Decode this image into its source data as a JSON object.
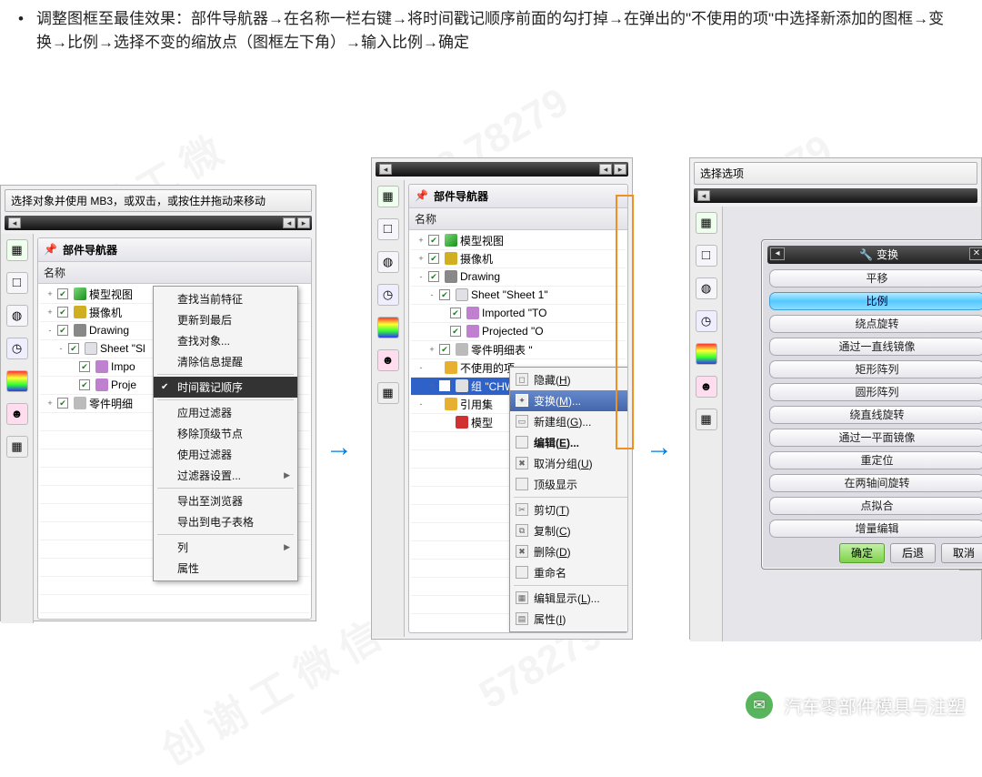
{
  "bullet": "调整图框至最佳效果：部件导航器→在名称一栏右键→将时间戳记顺序前面的勾打掉→在弹出的\"不使用的项\"中选择新添加的图框→变换→比例→选择不变的缩放点（图框左下角）→输入比例→确定",
  "shared": {
    "nav_title": "部件导航器",
    "col_name": "名称"
  },
  "shot1": {
    "hint": "选择对象并使用 MB3，或双击，或按住并拖动来移动",
    "tree": [
      {
        "pad": 0,
        "exp": "+",
        "chk": true,
        "ico": "cube3",
        "label": "模型视图"
      },
      {
        "pad": 0,
        "exp": "+",
        "chk": true,
        "ico": "cam",
        "label": "摄像机"
      },
      {
        "pad": 0,
        "exp": "-",
        "chk": true,
        "ico": "draw",
        "label": "Drawing"
      },
      {
        "pad": 1,
        "exp": "-",
        "chk": true,
        "ico": "sheet",
        "label": "Sheet \"Sl"
      },
      {
        "pad": 2,
        "exp": "",
        "chk": true,
        "ico": "view",
        "label": "Impo"
      },
      {
        "pad": 2,
        "exp": "",
        "chk": true,
        "ico": "view",
        "label": "Proje"
      },
      {
        "pad": 0,
        "exp": "+",
        "chk": true,
        "ico": "part",
        "label": "零件明细"
      }
    ],
    "ctx": {
      "items": [
        {
          "t": "查找当前特征"
        },
        {
          "t": "更新到最后"
        },
        {
          "t": "查找对象..."
        },
        {
          "t": "清除信息提醒"
        },
        {
          "sep": true
        },
        {
          "t": "时间戳记顺序",
          "check": true,
          "hi": true
        },
        {
          "sep": true
        },
        {
          "t": "应用过滤器"
        },
        {
          "t": "移除顶级节点"
        },
        {
          "t": "使用过滤器"
        },
        {
          "t": "过滤器设置...",
          "arr": true
        },
        {
          "sep": true
        },
        {
          "t": "导出至浏览器"
        },
        {
          "t": "导出到电子表格"
        },
        {
          "sep": true
        },
        {
          "t": "列",
          "arr": true
        },
        {
          "t": "属性"
        }
      ]
    }
  },
  "shot2": {
    "tree": [
      {
        "pad": 0,
        "exp": "+",
        "chk": true,
        "ico": "cube3",
        "label": "模型视图"
      },
      {
        "pad": 0,
        "exp": "+",
        "chk": true,
        "ico": "cam",
        "label": "摄像机"
      },
      {
        "pad": 0,
        "exp": "-",
        "chk": true,
        "ico": "draw",
        "label": "Drawing"
      },
      {
        "pad": 1,
        "exp": "-",
        "chk": true,
        "ico": "sheet",
        "label": "Sheet \"Sheet 1\""
      },
      {
        "pad": 2,
        "exp": "",
        "chk": true,
        "ico": "view",
        "label": "Imported \"TO"
      },
      {
        "pad": 2,
        "exp": "",
        "chk": true,
        "ico": "view",
        "label": "Projected \"O"
      },
      {
        "pad": 1,
        "exp": "+",
        "chk": true,
        "ico": "part",
        "label": "零件明细表 \""
      },
      {
        "pad": 0,
        "exp": "-",
        "chk": false,
        "ico": "folder",
        "label": "不使用的项"
      },
      {
        "pad": 1,
        "exp": "+",
        "chk": true,
        "ico": "grp",
        "label": "组 \"CHW08053\"",
        "sel": true
      },
      {
        "pad": 0,
        "exp": "-",
        "chk": false,
        "ico": "folder",
        "label": "引用集"
      },
      {
        "pad": 1,
        "exp": "",
        "chk": false,
        "ico": "model",
        "label": "模型"
      }
    ],
    "ctx": {
      "items": [
        {
          "t": "隐藏(H)",
          "u": "H",
          "ico": "◻"
        },
        {
          "t": "变换(M)...",
          "u": "M",
          "ico": "✦",
          "hi": true
        },
        {
          "t": "新建组(G)...",
          "u": "G",
          "ico": "▭"
        },
        {
          "t": "编辑(E)...",
          "u": "E",
          "bold": true
        },
        {
          "t": "取消分组(U)",
          "u": "U",
          "ico": "✖"
        },
        {
          "t": "顶级显示"
        },
        {
          "sep": true
        },
        {
          "t": "剪切(T)",
          "u": "T",
          "ico": "✂"
        },
        {
          "t": "复制(C)",
          "u": "C",
          "ico": "⧉"
        },
        {
          "t": "删除(D)",
          "u": "D",
          "ico": "✖"
        },
        {
          "t": "重命名"
        },
        {
          "sep": true
        },
        {
          "t": "编辑显示(L)...",
          "u": "L",
          "ico": "▦"
        },
        {
          "t": "属性(I)",
          "u": "I",
          "ico": "▤"
        }
      ]
    }
  },
  "shot3": {
    "hint": "选择选项",
    "dlg_title": "变换",
    "options": [
      {
        "t": "平移"
      },
      {
        "t": "比例",
        "sel": true
      },
      {
        "t": "绕点旋转"
      },
      {
        "t": "通过一直线镜像"
      },
      {
        "t": "矩形阵列"
      },
      {
        "t": "圆形阵列"
      },
      {
        "t": "绕直线旋转"
      },
      {
        "t": "通过一平面镜像"
      },
      {
        "t": "重定位"
      },
      {
        "t": "在两轴间旋转"
      },
      {
        "t": "点拟合"
      },
      {
        "t": "增量编辑"
      }
    ],
    "buttons": {
      "ok": "确定",
      "back": "后退",
      "cancel": "取消"
    }
  },
  "watermark_channel": "汽车零部件模具与注塑"
}
